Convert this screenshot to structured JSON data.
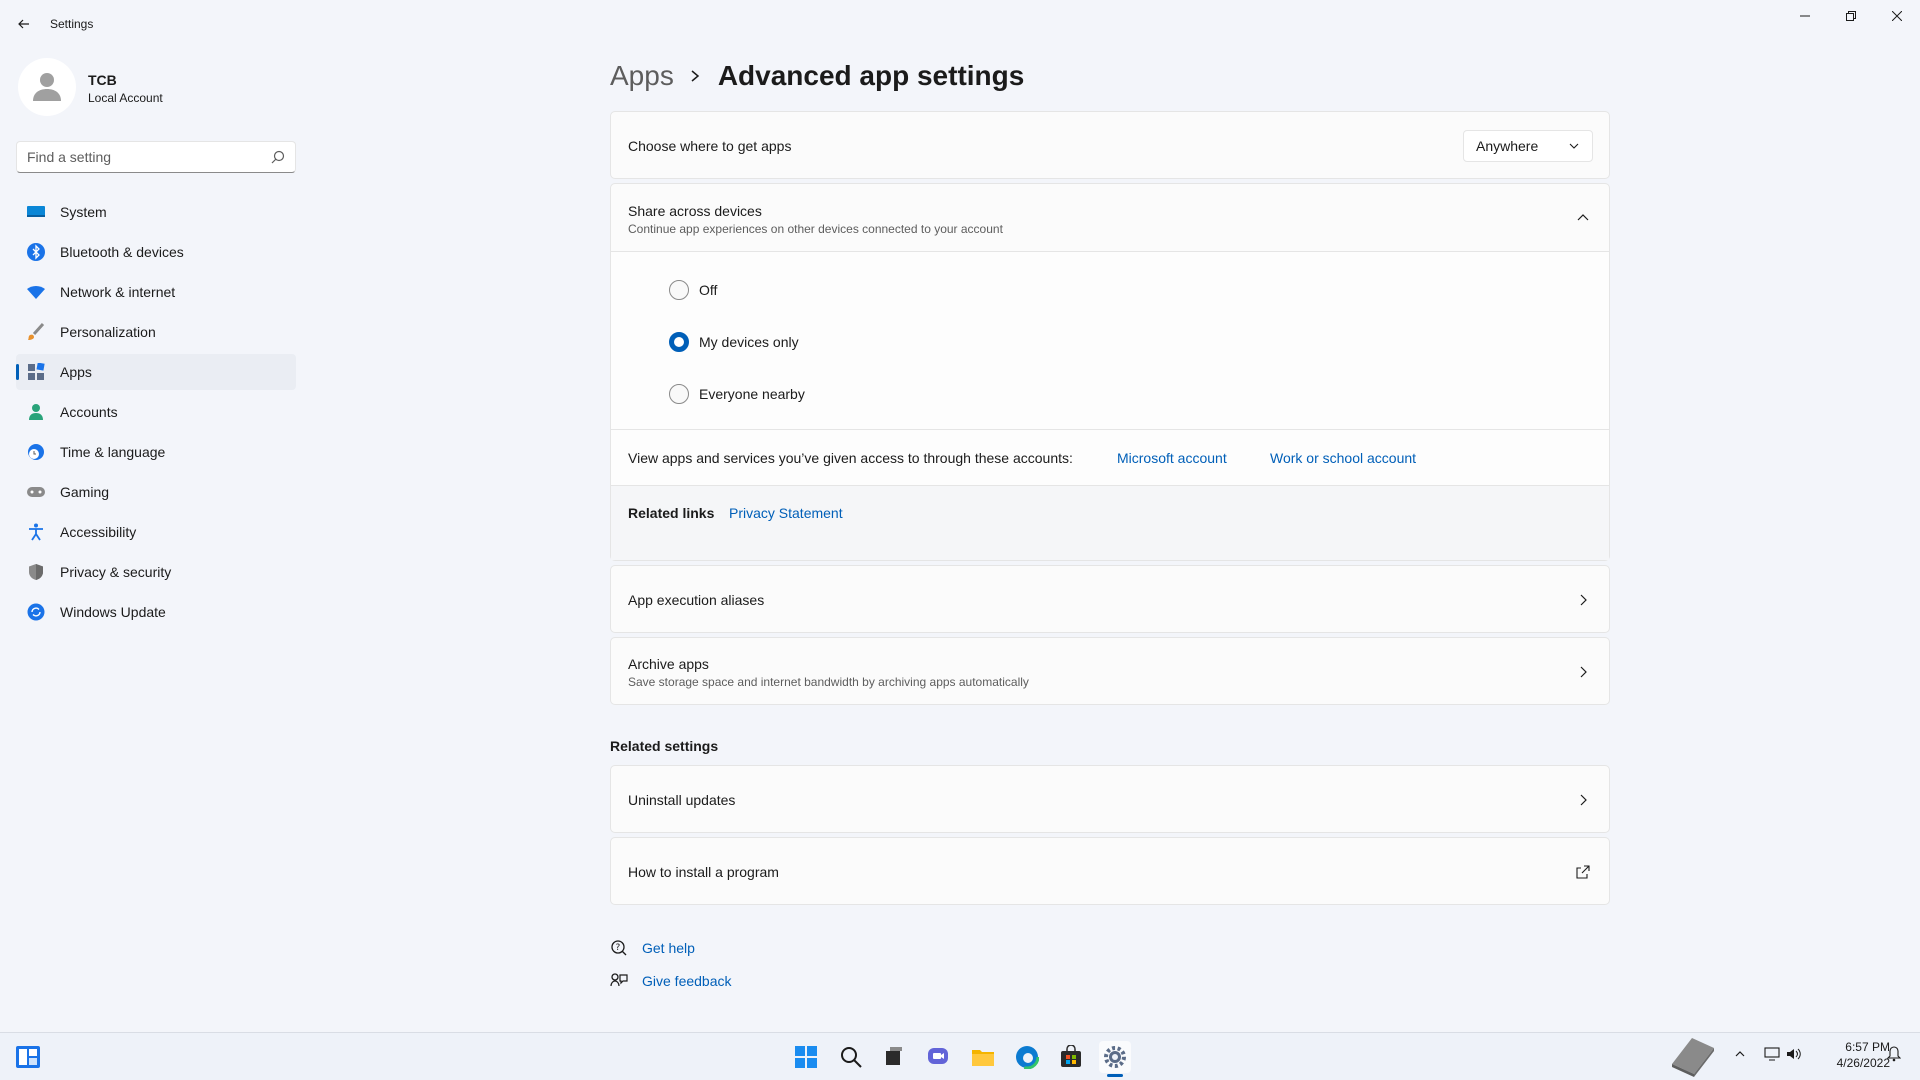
{
  "window": {
    "title": "Settings",
    "controls": [
      "minimize",
      "maximize",
      "close"
    ]
  },
  "profile": {
    "name": "TCB",
    "account_type": "Local Account"
  },
  "search": {
    "placeholder": "Find a setting"
  },
  "sidebar": {
    "items": [
      {
        "label": "System",
        "icon": "monitor-icon",
        "active": false
      },
      {
        "label": "Bluetooth & devices",
        "icon": "bluetooth-icon",
        "active": false
      },
      {
        "label": "Network & internet",
        "icon": "wifi-icon",
        "active": false
      },
      {
        "label": "Personalization",
        "icon": "brush-icon",
        "active": false
      },
      {
        "label": "Apps",
        "icon": "apps-icon",
        "active": true
      },
      {
        "label": "Accounts",
        "icon": "person-icon",
        "active": false
      },
      {
        "label": "Time & language",
        "icon": "globe-clock-icon",
        "active": false
      },
      {
        "label": "Gaming",
        "icon": "gamepad-icon",
        "active": false
      },
      {
        "label": "Accessibility",
        "icon": "accessibility-icon",
        "active": false
      },
      {
        "label": "Privacy & security",
        "icon": "shield-icon",
        "active": false
      },
      {
        "label": "Windows Update",
        "icon": "update-icon",
        "active": false
      }
    ]
  },
  "breadcrumb": {
    "parent": "Apps",
    "current": "Advanced app settings"
  },
  "choose_apps": {
    "title": "Choose where to get apps",
    "dropdown_value": "Anywhere"
  },
  "share": {
    "title": "Share across devices",
    "description": "Continue app experiences on other devices connected to your account",
    "options": [
      {
        "label": "Off",
        "checked": false
      },
      {
        "label": "My devices only",
        "checked": true
      },
      {
        "label": "Everyone nearby",
        "checked": false
      }
    ],
    "accounts_text": "View apps and services you’ve given access to through these accounts:",
    "microsoft_account": "Microsoft account",
    "work_account": "Work or school account",
    "related_links_label": "Related links",
    "privacy_statement": "Privacy Statement"
  },
  "aliases": {
    "title": "App execution aliases"
  },
  "archive": {
    "title": "Archive apps",
    "description": "Save storage space and internet bandwidth by archiving apps automatically"
  },
  "related_settings": {
    "heading": "Related settings",
    "uninstall": "Uninstall updates",
    "howto": "How to install a program"
  },
  "help": {
    "get_help": "Get help",
    "feedback": "Give feedback"
  },
  "taskbar": {
    "time": "6:57 PM",
    "date": "4/26/2022",
    "apps": [
      "start-icon",
      "search-icon",
      "task-view-icon",
      "chat-icon",
      "file-explorer-icon",
      "edge-icon",
      "store-icon",
      "settings-icon"
    ]
  },
  "colors": {
    "accent": "#005fb8",
    "background": "#f3f5fa",
    "card": "#fbfbfb"
  }
}
